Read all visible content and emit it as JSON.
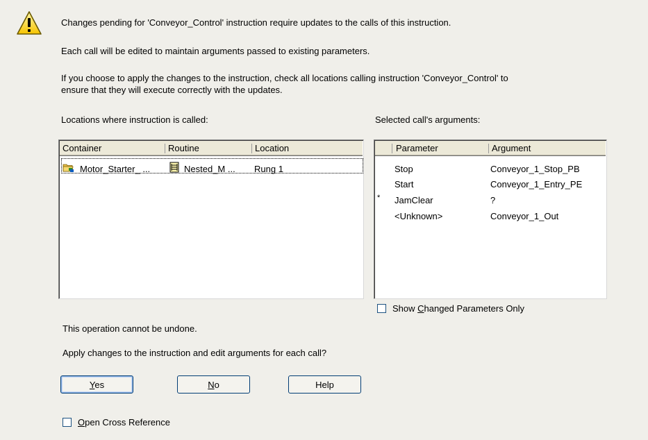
{
  "dialog": {
    "message_line1": "Changes pending for 'Conveyor_Control' instruction require updates to the calls of this instruction.",
    "message_line2": "Each call will be edited to maintain arguments passed to existing parameters.",
    "message_line3a": "If you choose to apply the changes to the instruction, check all locations calling instruction 'Conveyor_Control' to",
    "message_line3b": "ensure that they will execute correctly with the updates.",
    "locations_label": "Locations where instruction is called:",
    "arguments_label": "Selected call's arguments:",
    "undo_warning": "This operation cannot be undone.",
    "question": "Apply changes to the instruction and edit arguments for each call?"
  },
  "locations_table": {
    "columns": [
      "Container",
      "Routine",
      "Location"
    ],
    "rows": [
      {
        "container": "Motor_Starter_ ...",
        "routine": "Nested_M ...",
        "location": "Rung 1"
      }
    ]
  },
  "arguments_table": {
    "columns": [
      "Parameter",
      "Argument"
    ],
    "rows": [
      {
        "marker": "",
        "parameter": "Stop",
        "argument": "Conveyor_1_Stop_PB"
      },
      {
        "marker": "",
        "parameter": "Start",
        "argument": "Conveyor_1_Entry_PE"
      },
      {
        "marker": "*",
        "parameter": "JamClear",
        "argument": "?"
      },
      {
        "marker": "",
        "parameter": "<Unknown>",
        "argument": "Conveyor_1_Out"
      }
    ]
  },
  "checkboxes": {
    "show_changed": {
      "pre": "Show ",
      "accel": "C",
      "post": "hanged Parameters Only",
      "checked": false
    },
    "open_xref": {
      "pre": "",
      "accel": "O",
      "post": "pen Cross Reference",
      "checked": false
    }
  },
  "buttons": {
    "yes": {
      "accel": "Y",
      "rest": "es"
    },
    "no": {
      "accel": "N",
      "rest": "o"
    },
    "help": {
      "label": "Help"
    }
  },
  "icons": {
    "warning": "warning-triangle-icon",
    "container": "program-folder-icon",
    "routine": "routine-icon"
  },
  "colors": {
    "dialog_bg": "#f0efea",
    "warning_yellow": "#ffd800",
    "button_border": "#003c74"
  }
}
